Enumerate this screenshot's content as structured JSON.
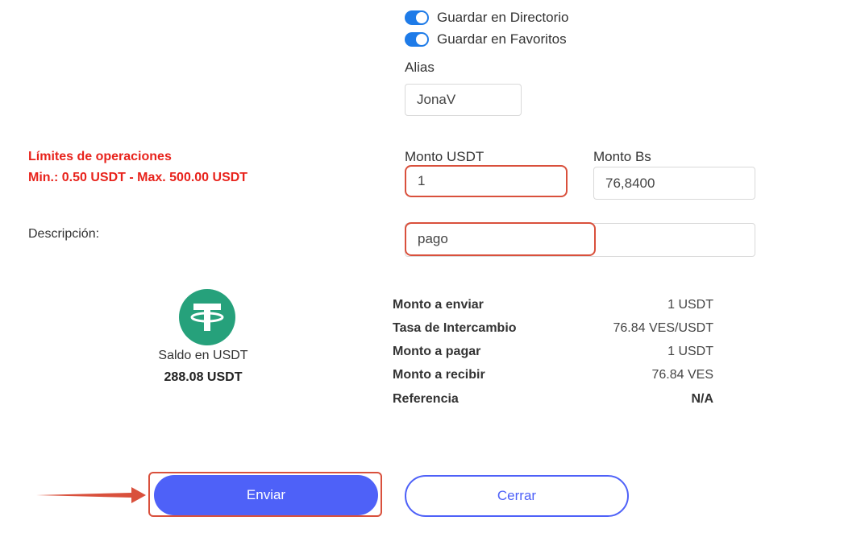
{
  "toggles": [
    {
      "label": "Guardar en Directorio",
      "on": true
    },
    {
      "label": "Guardar en Favoritos",
      "on": true
    }
  ],
  "alias": {
    "label": "Alias",
    "value": "JonaV"
  },
  "limits": {
    "title": "Límites de operaciones",
    "range": "Min.: 0.50 USDT - Max. 500.00 USDT"
  },
  "monto_usdt": {
    "label": "Monto USDT",
    "value": "1"
  },
  "monto_bs": {
    "label": "Monto Bs",
    "value": "76,8400"
  },
  "descripcion": {
    "label": "Descripción:",
    "value": "pago"
  },
  "balance": {
    "icon": "tether-usdt-icon",
    "label": "Saldo en USDT",
    "value": "288.08 USDT"
  },
  "summary": [
    {
      "label": "Monto a enviar",
      "value": "1 USDT"
    },
    {
      "label": "Tasa de Intercambio",
      "value": "76.84 VES/USDT"
    },
    {
      "label": "Monto a pagar",
      "value": "1 USDT"
    },
    {
      "label": "Monto a recibir",
      "value": "76.84 VES"
    },
    {
      "label": "Referencia",
      "value": "N/A"
    }
  ],
  "buttons": {
    "send": "Enviar",
    "close": "Cerrar"
  },
  "colors": {
    "accent": "#4e61f8",
    "toggle": "#1e7be8",
    "tether": "#26a17b",
    "limits": "#e8231c",
    "highlight": "#d9503c"
  }
}
